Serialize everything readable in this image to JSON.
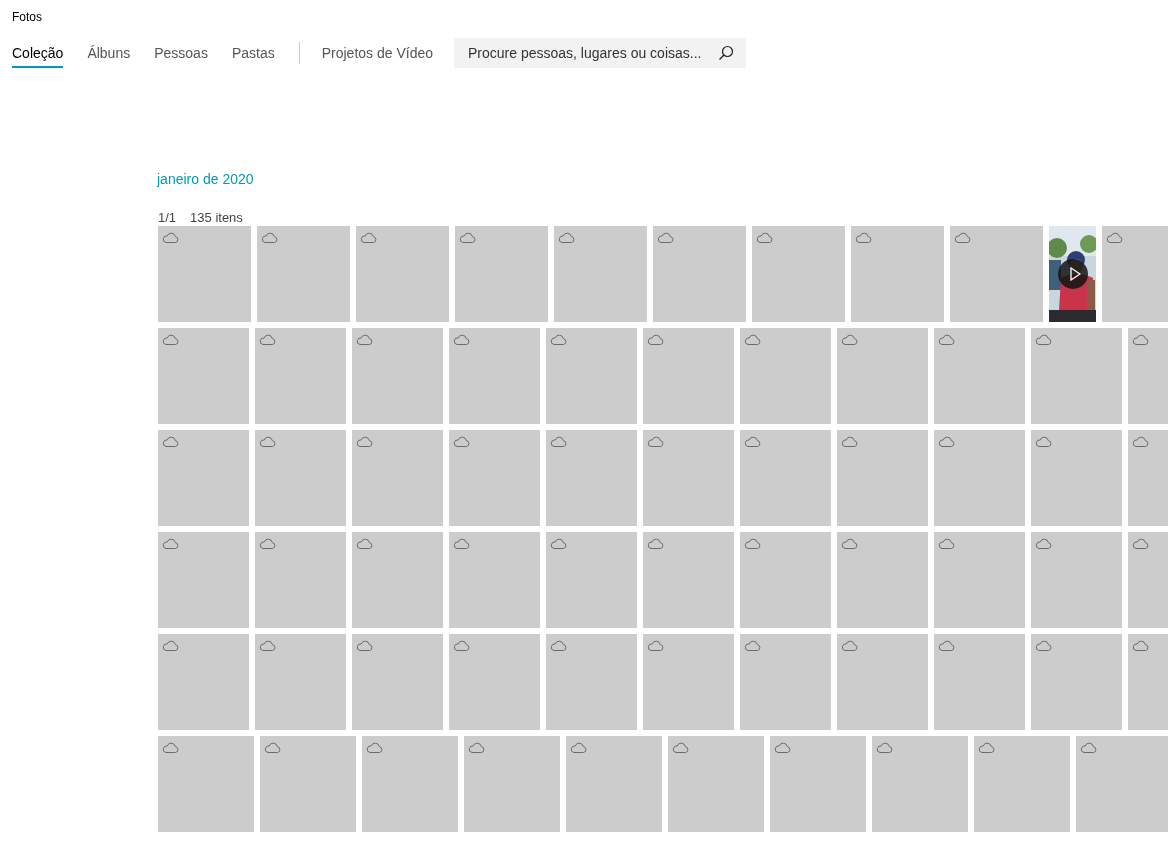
{
  "window": {
    "title": "Fotos"
  },
  "tabs": [
    {
      "label": "Coleção",
      "selected": true
    },
    {
      "label": "Álbuns",
      "selected": false
    },
    {
      "label": "Pessoas",
      "selected": false
    },
    {
      "label": "Pastas",
      "selected": false
    },
    {
      "label": "Projetos de Vídeo",
      "selected": false
    }
  ],
  "search": {
    "placeholder": "Procure pessoas, lugares ou coisas..."
  },
  "section": {
    "title": "janeiro de 2020",
    "page": "1/1",
    "count": "135 itens"
  },
  "grid": {
    "rows": [
      {
        "tiles": [
          {
            "kind": "cloud"
          },
          {
            "kind": "cloud"
          },
          {
            "kind": "cloud"
          },
          {
            "kind": "cloud"
          },
          {
            "kind": "cloud"
          },
          {
            "kind": "cloud"
          },
          {
            "kind": "cloud"
          },
          {
            "kind": "cloud"
          },
          {
            "kind": "cloud"
          },
          {
            "kind": "video"
          },
          {
            "kind": "cloud"
          }
        ]
      },
      {
        "tiles": [
          {
            "kind": "cloud"
          },
          {
            "kind": "cloud"
          },
          {
            "kind": "cloud"
          },
          {
            "kind": "cloud"
          },
          {
            "kind": "cloud"
          },
          {
            "kind": "cloud"
          },
          {
            "kind": "cloud"
          },
          {
            "kind": "cloud"
          },
          {
            "kind": "cloud"
          },
          {
            "kind": "cloud"
          },
          {
            "kind": "cloud"
          }
        ]
      },
      {
        "tiles": [
          {
            "kind": "cloud"
          },
          {
            "kind": "cloud"
          },
          {
            "kind": "cloud"
          },
          {
            "kind": "cloud"
          },
          {
            "kind": "cloud"
          },
          {
            "kind": "cloud"
          },
          {
            "kind": "cloud"
          },
          {
            "kind": "cloud"
          },
          {
            "kind": "cloud"
          },
          {
            "kind": "cloud"
          },
          {
            "kind": "cloud"
          }
        ]
      },
      {
        "tiles": [
          {
            "kind": "cloud"
          },
          {
            "kind": "cloud"
          },
          {
            "kind": "cloud"
          },
          {
            "kind": "cloud"
          },
          {
            "kind": "cloud"
          },
          {
            "kind": "cloud"
          },
          {
            "kind": "cloud"
          },
          {
            "kind": "cloud"
          },
          {
            "kind": "cloud"
          },
          {
            "kind": "cloud"
          },
          {
            "kind": "cloud"
          }
        ]
      },
      {
        "tiles": [
          {
            "kind": "cloud"
          },
          {
            "kind": "cloud"
          },
          {
            "kind": "cloud"
          },
          {
            "kind": "cloud"
          },
          {
            "kind": "cloud"
          },
          {
            "kind": "cloud"
          },
          {
            "kind": "cloud"
          },
          {
            "kind": "cloud"
          },
          {
            "kind": "cloud"
          },
          {
            "kind": "cloud"
          },
          {
            "kind": "cloud"
          }
        ]
      },
      {
        "tiles": [
          {
            "kind": "cloud"
          },
          {
            "kind": "cloud"
          },
          {
            "kind": "cloud"
          },
          {
            "kind": "cloud"
          },
          {
            "kind": "cloud"
          },
          {
            "kind": "cloud"
          },
          {
            "kind": "cloud"
          },
          {
            "kind": "cloud"
          },
          {
            "kind": "cloud"
          },
          {
            "kind": "cloud"
          }
        ]
      }
    ]
  }
}
